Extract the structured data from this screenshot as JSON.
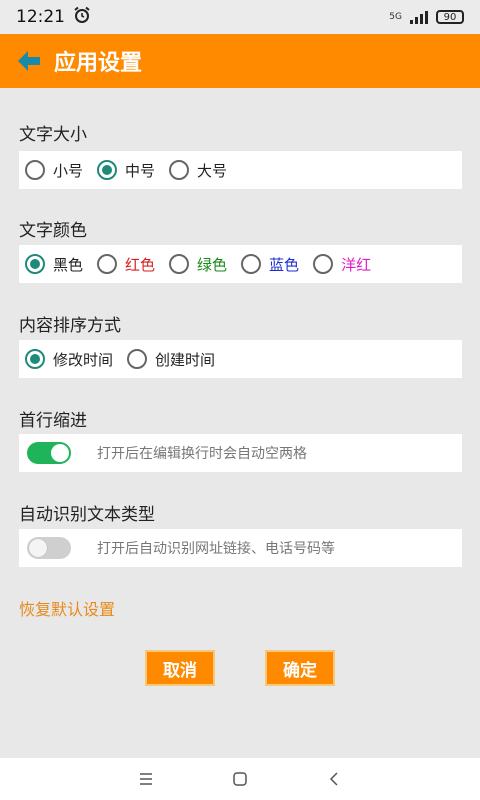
{
  "status_bar": {
    "time": "12:21",
    "network": "5G",
    "battery": "90"
  },
  "header": {
    "title": "应用设置"
  },
  "sections": {
    "font_size": {
      "title": "文字大小",
      "options": [
        "小号",
        "中号",
        "大号"
      ],
      "selected": "中号"
    },
    "font_color": {
      "title": "文字颜色",
      "options": [
        {
          "label": "黑色",
          "color": "#222222"
        },
        {
          "label": "红色",
          "color": "#d81e1e"
        },
        {
          "label": "绿色",
          "color": "#1a8a1a"
        },
        {
          "label": "蓝色",
          "color": "#1e2fd0"
        },
        {
          "label": "洋红",
          "color": "#e01ec8"
        }
      ],
      "selected": "黑色"
    },
    "sort": {
      "title": "内容排序方式",
      "options": [
        "修改时间",
        "创建时间"
      ],
      "selected": "修改时间"
    },
    "indent": {
      "title": "首行缩进",
      "enabled": true,
      "hint": "打开后在编辑换行时会自动空两格"
    },
    "auto_detect": {
      "title": "自动识别文本类型",
      "enabled": false,
      "hint": "打开后自动识别网址链接、电话号码等"
    }
  },
  "restore_label": "恢复默认设置",
  "buttons": {
    "cancel": "取消",
    "confirm": "确定"
  },
  "colors": {
    "accent": "#ff8a00",
    "radio_checked": "#1f8a7a",
    "toggle_on": "#1fb35a"
  }
}
